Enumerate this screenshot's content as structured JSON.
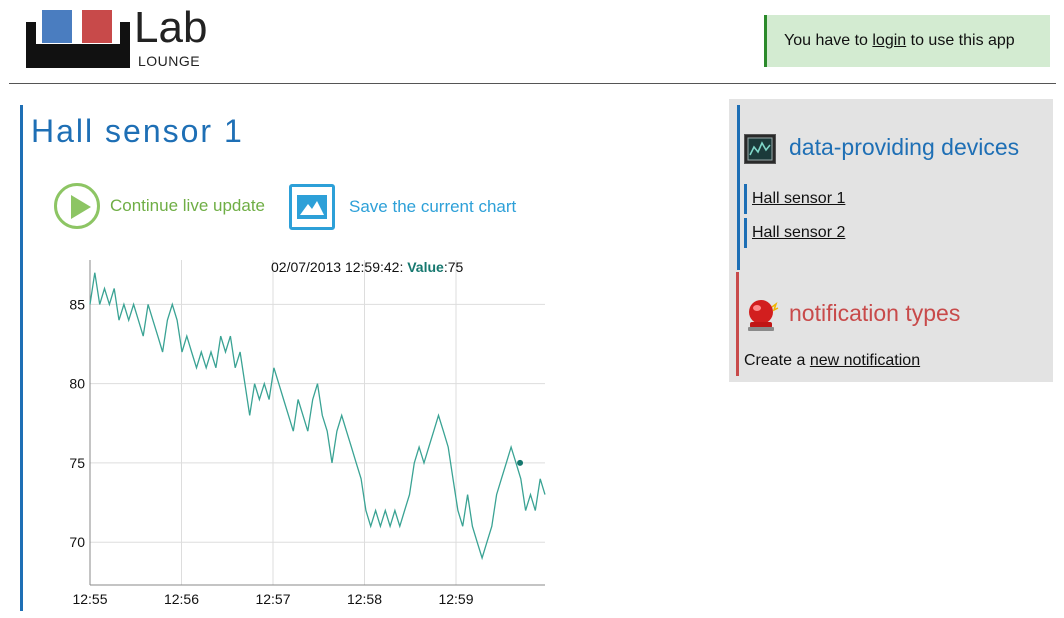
{
  "header": {
    "logo_word": "Lab",
    "logo_sub": "LOUNGE",
    "login_prefix": "You have to ",
    "login_link": "login",
    "login_suffix": " to use this app"
  },
  "main": {
    "title": "Hall sensor 1",
    "live_button": "Continue live update",
    "save_button": "Save the current chart",
    "tooltip_date": "02/07/2013 12:59:42:",
    "tooltip_value_label": "Value",
    "tooltip_value": ":75"
  },
  "sidebar": {
    "devices_title": "data-providing devices",
    "devices": [
      "Hall sensor 1",
      "Hall sensor 2"
    ],
    "notif_title": "notification types",
    "notif_prefix": "Create a ",
    "notif_link": "new notification"
  },
  "colors": {
    "accent_blue": "#1e6fb5",
    "accent_red": "#c84a4a",
    "green": "#6fae45",
    "line": "#3aa394"
  },
  "chart_data": {
    "type": "line",
    "xlabel": "",
    "ylabel": "",
    "ylim": [
      67.3,
      87.8
    ],
    "y_ticks": [
      70,
      75,
      80,
      85
    ],
    "x_ticks": [
      "12:55",
      "12:56",
      "12:57",
      "12:58",
      "12:59"
    ],
    "x_range_minutes": [
      0,
      5.0
    ],
    "grid": true,
    "highlight": {
      "x_label": "12:59:42",
      "value": 75
    },
    "series": [
      {
        "values": [
          85,
          87,
          85,
          86,
          85,
          86,
          84,
          85,
          84,
          85,
          84,
          83,
          85,
          84,
          83,
          82,
          84,
          85,
          84,
          82,
          83,
          82,
          81,
          82,
          81,
          82,
          81,
          83,
          82,
          83,
          81,
          82,
          80,
          78,
          80,
          79,
          80,
          79,
          81,
          80,
          79,
          78,
          77,
          79,
          78,
          77,
          79,
          80,
          78,
          77,
          75,
          77,
          78,
          77,
          76,
          75,
          74,
          72,
          71,
          72,
          71,
          72,
          71,
          72,
          71,
          72,
          73,
          75,
          76,
          75,
          76,
          77,
          78,
          77,
          76,
          74,
          72,
          71,
          73,
          71,
          70,
          69,
          70,
          71,
          73,
          74,
          75,
          76,
          75,
          74,
          72,
          73,
          72,
          74,
          73
        ]
      }
    ]
  }
}
